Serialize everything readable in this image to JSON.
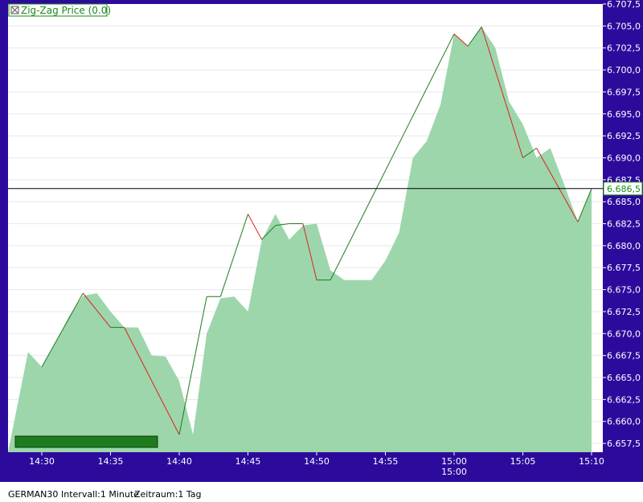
{
  "chart_data": {
    "type": "area",
    "title": "Zig-Zag Price (0.0)",
    "ylim": [
      6656.5,
      6707.5
    ],
    "y_ticks": [
      "6.707,5",
      "6.705,0",
      "6.702,5",
      "6.700,0",
      "6.697,5",
      "6.695,0",
      "6.692,5",
      "6.690,0",
      "6.687,5",
      "6.685,0",
      "6.682,5",
      "6.680,0",
      "6.677,5",
      "6.675,0",
      "6.672,5",
      "6.670,0",
      "6.667,5",
      "6.665,0",
      "6.662,5",
      "6.660,0",
      "6.657,5"
    ],
    "x_ticks": [
      "14:30",
      "14:35",
      "14:40",
      "14:45",
      "14:50",
      "14:55",
      "15:00",
      "15:05",
      "15:10"
    ],
    "x_tick_secondary": {
      "15:00": "15:00"
    },
    "current_value": 6686.5,
    "current_value_label": "6.686,5",
    "series": [
      {
        "x": [
          "14:29",
          "14:30",
          "14:31",
          "14:32",
          "14:33",
          "14:34",
          "14:35",
          "14:36",
          "14:37",
          "14:38",
          "14:39",
          "14:40",
          "14:41",
          "14:42",
          "14:43",
          "14:44",
          "14:45",
          "14:46",
          "14:47",
          "14:48",
          "14:49",
          "14:50",
          "14:51",
          "14:52",
          "14:53",
          "14:54",
          "14:55",
          "14:56",
          "14:57",
          "14:58",
          "14:59",
          "15:00",
          "15:01",
          "15:02",
          "15:03",
          "15:04",
          "15:05",
          "15:06",
          "15:07",
          "15:08",
          "15:09",
          "15:10"
        ],
        "values": [
          6667.9,
          6666.2,
          6668.9,
          6672.0,
          6674.3,
          6674.6,
          6672.5,
          6670.7,
          6670.7,
          6667.5,
          6667.4,
          6664.6,
          6658.5,
          6670.0,
          6674.0,
          6674.2,
          6672.5,
          6680.6,
          6683.6,
          6680.7,
          6682.3,
          6682.5,
          6677.2,
          6676.1,
          6676.1,
          6676.1,
          6678.3,
          6681.5,
          6690.0,
          6691.9,
          6696.0,
          6704.1,
          6702.7,
          6704.9,
          6702.5,
          6696.4,
          6693.8,
          6690.0,
          6691.1,
          6687.0,
          6682.7,
          6686.5
        ]
      }
    ],
    "zigzag": {
      "x": [
        "14:30",
        "14:33",
        "14:35",
        "14:36",
        "14:40",
        "14:42",
        "14:43",
        "14:45",
        "14:46",
        "14:47",
        "14:48",
        "14:49",
        "14:50",
        "14:51",
        "15:00",
        "15:01",
        "15:02",
        "15:05",
        "15:06",
        "15:09",
        "15:10"
      ],
      "values": [
        6666.2,
        6674.6,
        6670.7,
        6670.7,
        6658.5,
        6674.2,
        6674.2,
        6683.6,
        6680.7,
        6682.3,
        6682.5,
        6682.5,
        6676.1,
        6676.1,
        6704.1,
        6702.7,
        6704.9,
        6690.0,
        6691.1,
        6682.7,
        6686.5
      ]
    },
    "colors": {
      "background": "#2c0b9c",
      "plot": "#ffffff",
      "area": "#9dd6ab",
      "up": "#1d7a1d",
      "down": "#e02020",
      "price_label": "#1a8a1a",
      "grid": "#e8e8e8",
      "progress": "#1e7c1e"
    }
  },
  "status_bar": {
    "symbol": "GERMAN30",
    "interval": "Intervall:1 Minute",
    "range": "Zeitraum:1 Tag"
  }
}
